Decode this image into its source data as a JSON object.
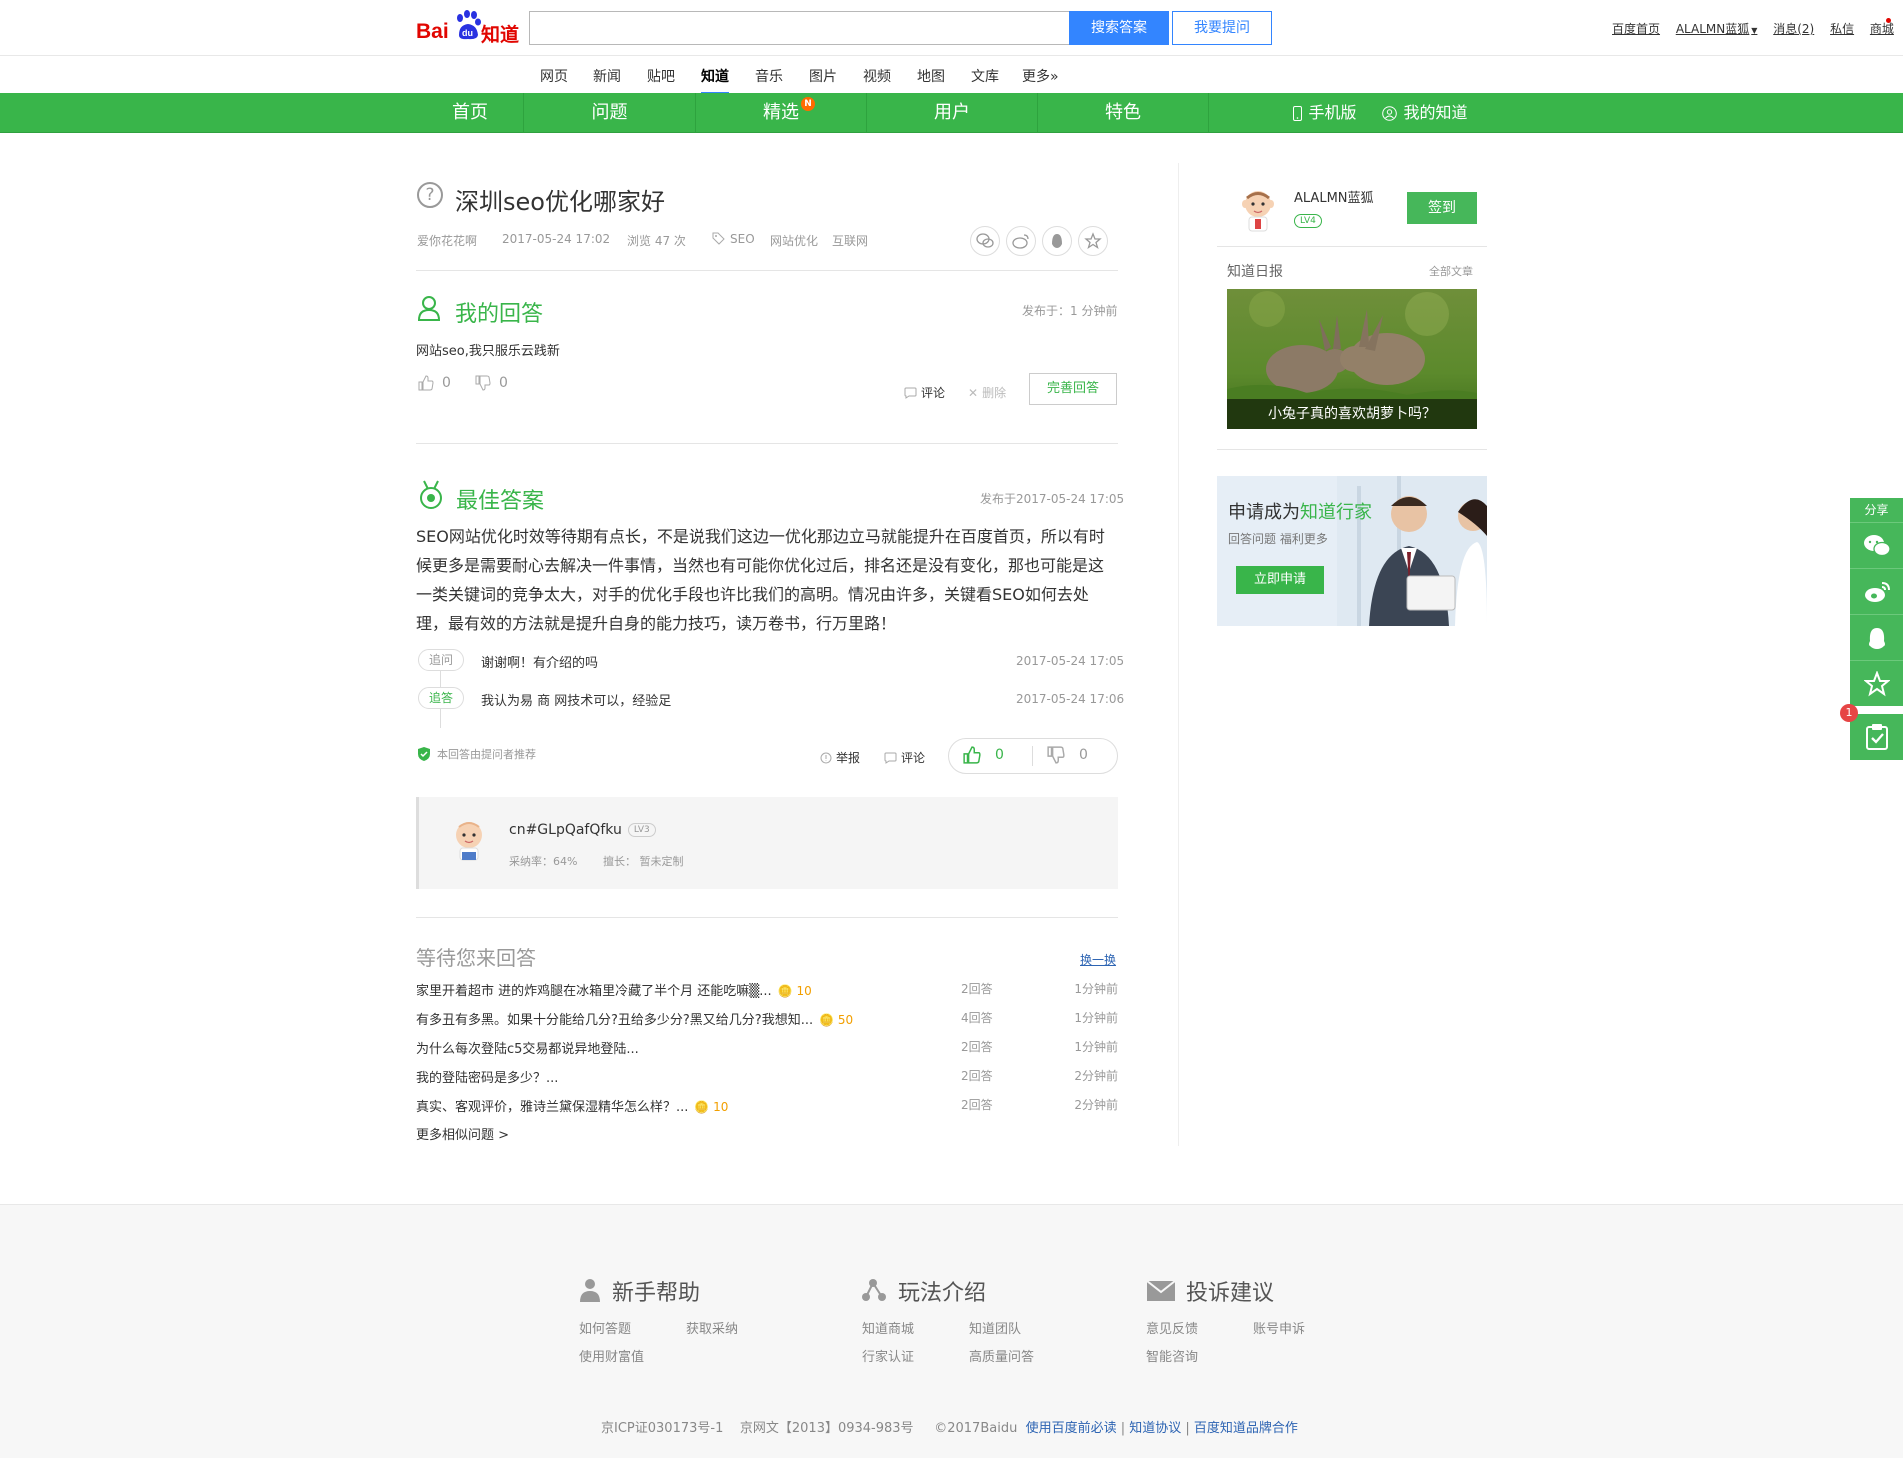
{
  "header": {
    "logo_bai": "Bai",
    "logo_du": "du",
    "logo_zhidao": "知道",
    "search_value": "",
    "search_button": "搜索答案",
    "ask_button": "我要提问",
    "links": [
      "百度首页",
      "ALALMN蓝狐",
      "消息(2)",
      "私信",
      "商城"
    ]
  },
  "channels": [
    {
      "label": "网页"
    },
    {
      "label": "新闻"
    },
    {
      "label": "贴吧"
    },
    {
      "label": "知道"
    },
    {
      "label": "音乐"
    },
    {
      "label": "图片"
    },
    {
      "label": "视频"
    },
    {
      "label": "地图"
    },
    {
      "label": "文库"
    },
    {
      "label": "更多»"
    }
  ],
  "green_nav": {
    "items": [
      "首页",
      "问题",
      "精选",
      "用户",
      "特色"
    ],
    "badge": "N",
    "mobile": "手机版",
    "my": "我的知道"
  },
  "question": {
    "icon": "?",
    "title": "深圳seo优化哪家好",
    "asker": "爱你花花啊",
    "date": "2017-05-24 17:02",
    "views": "浏览 47 次",
    "tags": [
      "SEO",
      "网站优化",
      "互联网"
    ]
  },
  "my_answer": {
    "title": "我的回答",
    "time": "发布于：1 分钟前",
    "text": "网站seo,我只服乐云践新",
    "up": "0",
    "down": "0",
    "comment": "评论",
    "delete": "删除",
    "improve": "完善回答"
  },
  "best_answer": {
    "title": "最佳答案",
    "time": "发布于2017-05-24 17:05",
    "text": "SEO网站优化时效等待期有点长，不是说我们这边一优化那边立马就能提升在百度首页，所以有时候更多是需要耐心去解决一件事情，当然也有可能你优化过后，排名还是没有变化，那也可能是这一类关键词的竞争太大，对手的优化手段也许比我们的高明。情况由许多，关键看SEO如何去处理，最有效的方法就是提升自身的能力技巧，读万卷书，行万里路！",
    "followups": [
      {
        "tag": "追问",
        "text": "谢谢啊！有介绍的吗",
        "time": "2017-05-24 17:05"
      },
      {
        "tag": "追答",
        "text": "我认为易 商 网技术可以，经验足",
        "time": "2017-05-24 17:06"
      }
    ],
    "recommended": "本回答由提问者推荐",
    "report": "举报",
    "comment": "评论",
    "up": "0",
    "down": "0"
  },
  "answerer": {
    "name": "cn#GLpQafQfku",
    "level": "LV3",
    "adopt_rate": "采纳率：64%",
    "specialty": "擅长： 暂未定制"
  },
  "waiting": {
    "title": "等待您来回答",
    "refresh": "换一换",
    "rows": [
      {
        "q": "家里开着超市 进的炸鸡腿在冰箱里冷藏了半个月 还能吃嘛▒...",
        "coin": "10",
        "answers": "2回答",
        "time": "1分钟前"
      },
      {
        "q": "有多丑有多黑。如果十分能给几分?丑给多少分?黑又给几分?我想知...",
        "coin": "50",
        "answers": "4回答",
        "time": "1分钟前"
      },
      {
        "q": "为什么每次登陆c5交易都说异地登陆...",
        "coin": "",
        "answers": "2回答",
        "time": "1分钟前"
      },
      {
        "q": "我的登陆密码是多少？...",
        "coin": "",
        "answers": "2回答",
        "time": "2分钟前"
      },
      {
        "q": "真实、客观评价，雅诗兰黛保湿精华怎么样？...",
        "coin": "10",
        "answers": "2回答",
        "time": "2分钟前"
      }
    ],
    "more": "更多相似问题 >"
  },
  "sidebar": {
    "user_name": "ALALMN蓝狐",
    "level": "LV4",
    "sign_button": "签到",
    "daily_title": "知道日报",
    "daily_all": "全部文章",
    "daily_caption": "小兔子真的喜欢胡萝卜吗？",
    "ad_title_pre": "申请成为",
    "ad_title_em": "知道行家",
    "ad_sub": "回答问题  福利更多",
    "ad_button": "立即申请"
  },
  "float_share": {
    "title": "分享",
    "badge": "1"
  },
  "footer": {
    "sections": [
      {
        "title": "新手帮助",
        "links": [
          "如何答题",
          "获取采纳",
          "使用财富值"
        ]
      },
      {
        "title": "玩法介绍",
        "links": [
          "知道商城",
          "知道团队",
          "行家认证",
          "高质量问答"
        ]
      },
      {
        "title": "投诉建议",
        "links": [
          "意见反馈",
          "账号申诉",
          "智能咨询"
        ]
      }
    ],
    "icp": "京ICP证030173号-1",
    "netcul": "京网文【2013】0934-983号",
    "copy": "©2017Baidu",
    "must_read": "使用百度前必读",
    "agreement": "知道协议",
    "brand": "百度知道品牌合作"
  },
  "colors": {
    "brand_green": "#39b54a",
    "search_blue": "#3385ff",
    "logo_red": "#e10601",
    "coin_orange": "#f29f00"
  }
}
